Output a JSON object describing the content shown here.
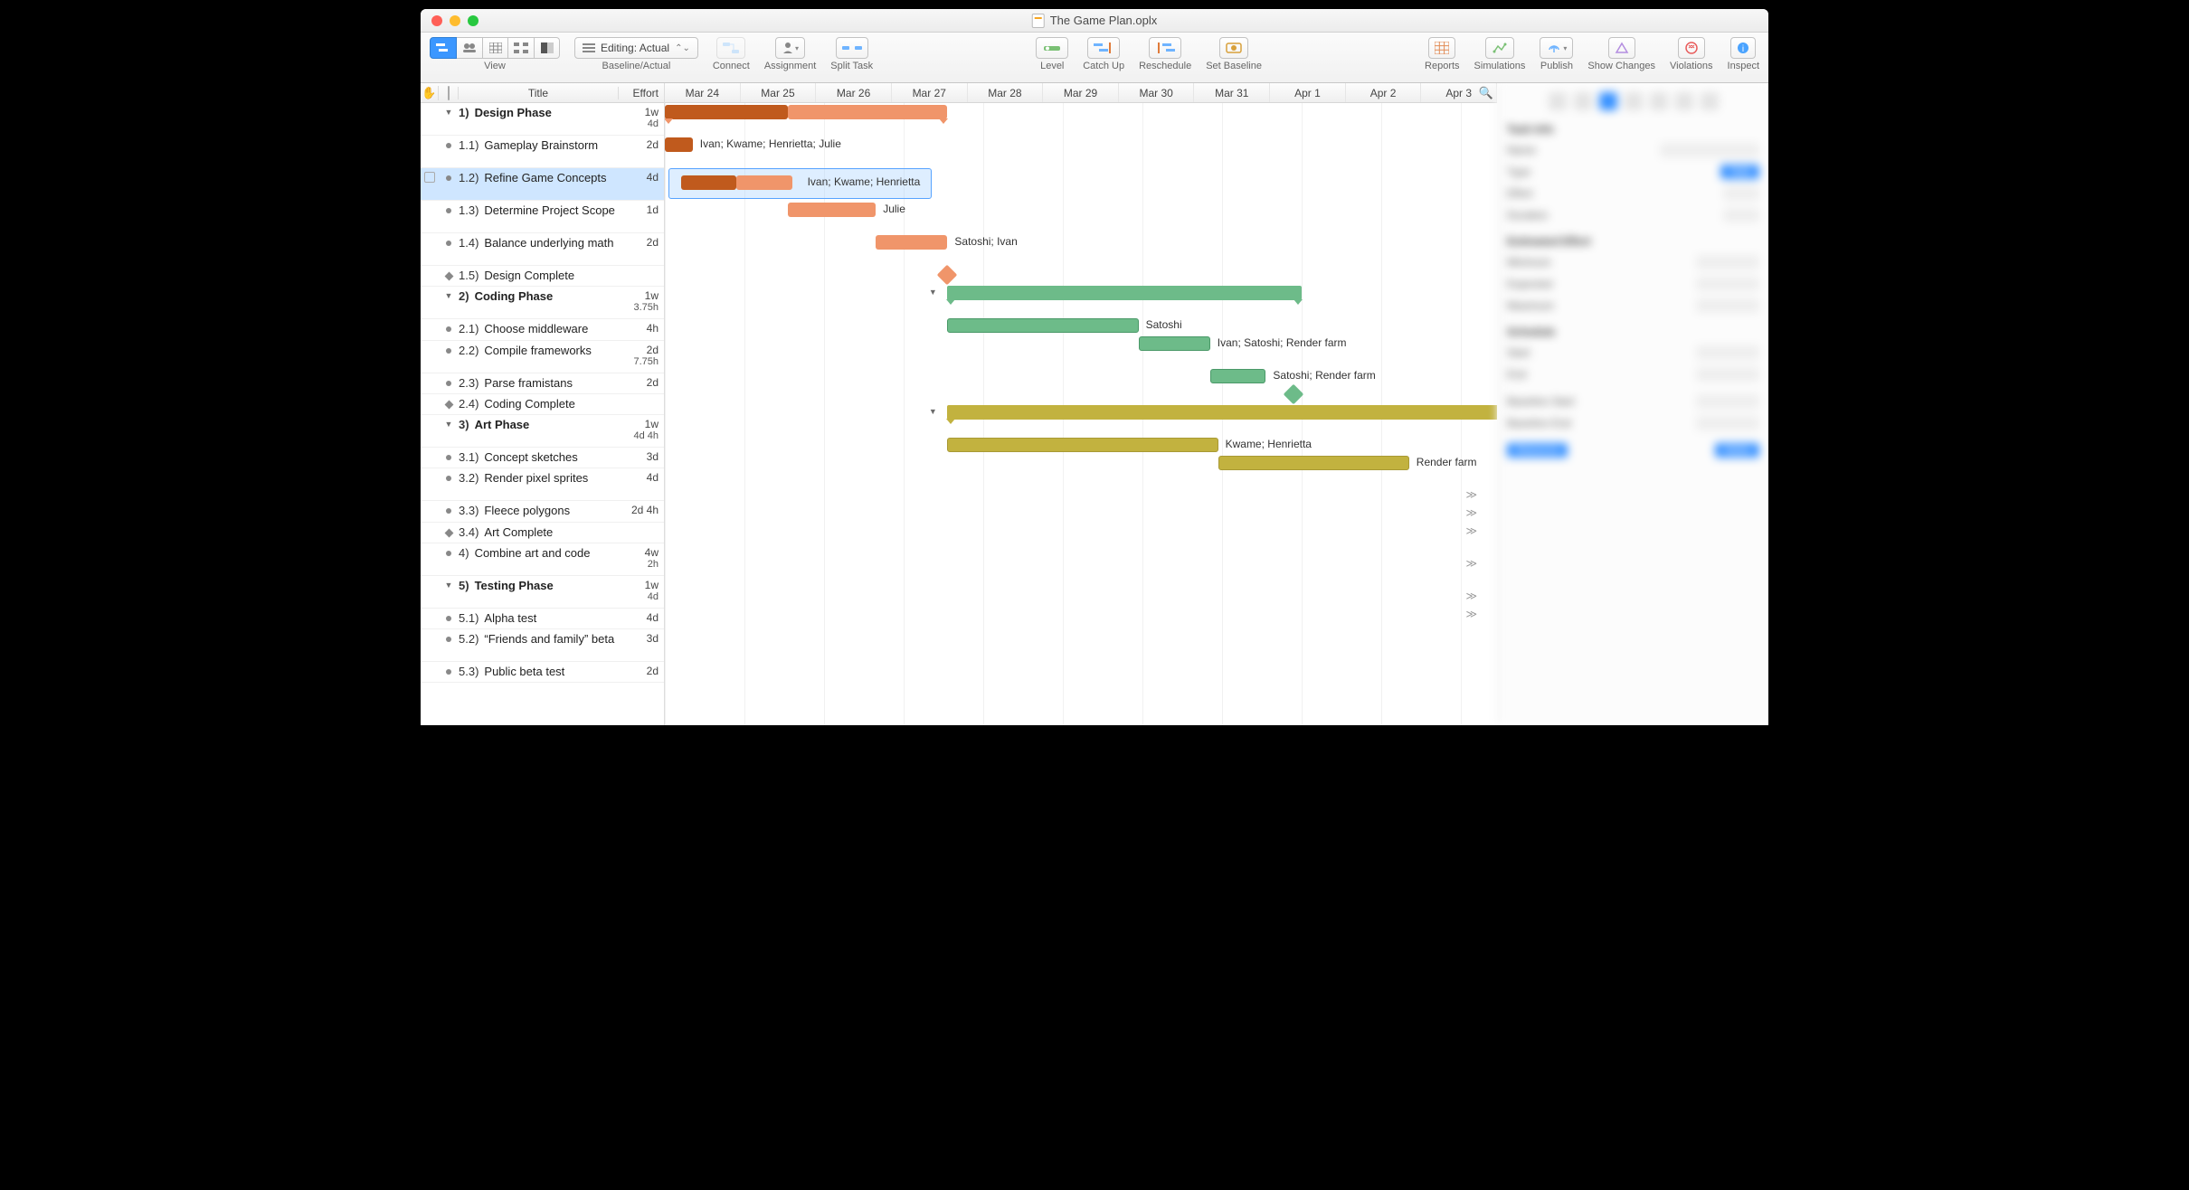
{
  "window": {
    "title": "The Game Plan.oplx"
  },
  "toolbar": {
    "view_label": "View",
    "baseline_label": "Baseline/Actual",
    "baseline_select": "Editing: Actual",
    "connect_label": "Connect",
    "assignment_label": "Assignment",
    "split_label": "Split Task",
    "level_label": "Level",
    "catchup_label": "Catch Up",
    "reschedule_label": "Reschedule",
    "setbaseline_label": "Set Baseline",
    "reports_label": "Reports",
    "simulations_label": "Simulations",
    "publish_label": "Publish",
    "showchanges_label": "Show Changes",
    "violations_label": "Violations",
    "inspect_label": "Inspect"
  },
  "columns": {
    "title": "Title",
    "effort": "Effort"
  },
  "timeline": {
    "dates": [
      "Mar 24",
      "Mar 25",
      "Mar 26",
      "Mar 27",
      "Mar 28",
      "Mar 29",
      "Mar 30",
      "Mar 31",
      "Apr 1",
      "Apr 2",
      "Apr 3"
    ]
  },
  "tasks": [
    {
      "id": "1",
      "title": "Design Phase",
      "effort": "1w",
      "effort2": "4d",
      "type": "group"
    },
    {
      "id": "1.1",
      "title": "Gameplay Brainstorm",
      "effort": "2d",
      "type": "task",
      "assignees": "Ivan; Kwame; Henrietta; Julie"
    },
    {
      "id": "1.2",
      "title": "Refine Game Concepts",
      "effort": "4d",
      "type": "task",
      "assignees": "Ivan; Kwame; Henrietta"
    },
    {
      "id": "1.3",
      "title": "Determine Project Scope",
      "effort": "1d",
      "type": "task",
      "assignees": "Julie"
    },
    {
      "id": "1.4",
      "title": "Balance underlying math",
      "effort": "2d",
      "type": "task",
      "assignees": "Satoshi; Ivan"
    },
    {
      "id": "1.5",
      "title": "Design Complete",
      "effort": "",
      "type": "milestone"
    },
    {
      "id": "2",
      "title": "Coding Phase",
      "effort": "1w",
      "effort2": "3.75h",
      "type": "group"
    },
    {
      "id": "2.1",
      "title": "Choose middleware",
      "effort": "4h",
      "type": "task",
      "assignees": "Satoshi"
    },
    {
      "id": "2.2",
      "title": "Compile frameworks",
      "effort": "2d",
      "effort2": "7.75h",
      "type": "task",
      "assignees": "Ivan; Satoshi; Render farm"
    },
    {
      "id": "2.3",
      "title": "Parse framistans",
      "effort": "2d",
      "type": "task",
      "assignees": "Satoshi; Render farm"
    },
    {
      "id": "2.4",
      "title": "Coding Complete",
      "effort": "",
      "type": "milestone"
    },
    {
      "id": "3",
      "title": "Art Phase",
      "effort": "1w",
      "effort2": "4d 4h",
      "type": "group"
    },
    {
      "id": "3.1",
      "title": "Concept sketches",
      "effort": "3d",
      "type": "task",
      "assignees": "Kwame; Henrietta"
    },
    {
      "id": "3.2",
      "title": "Render pixel sprites",
      "effort": "4d",
      "type": "task",
      "assignees": "Render farm"
    },
    {
      "id": "3.3",
      "title": "Fleece polygons",
      "effort": "2d 4h",
      "type": "task"
    },
    {
      "id": "3.4",
      "title": "Art Complete",
      "effort": "",
      "type": "milestone"
    },
    {
      "id": "4",
      "title": "Combine art and code",
      "effort": "4w",
      "effort2": "2h",
      "type": "task-top"
    },
    {
      "id": "5",
      "title": "Testing Phase",
      "effort": "1w",
      "effort2": "4d",
      "type": "group"
    },
    {
      "id": "5.1",
      "title": "Alpha test",
      "effort": "4d",
      "type": "task"
    },
    {
      "id": "5.2",
      "title": "“Friends and family” beta",
      "effort": "3d",
      "type": "task"
    },
    {
      "id": "5.3",
      "title": "Public beta test",
      "effort": "2d",
      "type": "task"
    }
  ],
  "colors": {
    "design_dark": "#c05a1d",
    "design_light": "#f0956a",
    "coding": "#6dbb89",
    "coding_dark": "#4faa72",
    "art": "#c2b23f",
    "select": "#cfe6ff"
  }
}
